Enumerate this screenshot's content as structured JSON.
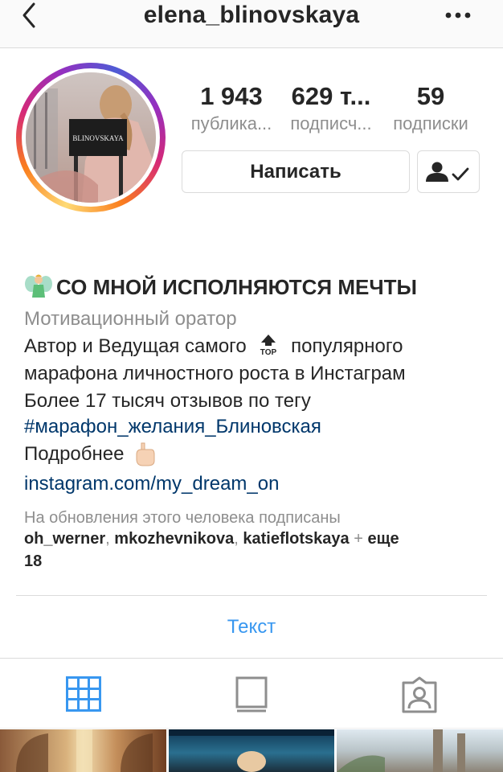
{
  "header": {
    "title": "elena_blinovskaya",
    "back_icon": "chevron-left-icon",
    "more_icon": "ellipsis-icon"
  },
  "profile": {
    "avatar_text": "BLINOVSKAYA",
    "stats": [
      {
        "value": "1 943",
        "label": "публика..."
      },
      {
        "value": "629 т...",
        "label": "подписч..."
      },
      {
        "value": "59",
        "label": "подписки"
      }
    ],
    "message_button": "Написать",
    "follow_icon": "person-check-icon"
  },
  "bio": {
    "name": "СО МНОЙ ИСПОЛНЯЮТСЯ МЕЧТЫ",
    "name_emoji": "fairy-emoji",
    "category": "Мотивационный оратор",
    "line1_a": "Автор и Ведущая самого",
    "line1_emoji": "top-arrow-emoji",
    "line1_b": "популярного",
    "line2": "марафона личностного роста в Инстаграм",
    "line3": "Более 17 тысяч отзывов по тегу",
    "hashtag": "#марафон_желания_Блиновская",
    "more": "Подробнее",
    "more_emoji": "pointing-down-emoji",
    "link": "instagram.com/my_dream_on"
  },
  "followed_by": {
    "intro": "На обновления этого человека подписаны",
    "names": [
      "oh_werner",
      "mkozhevnikova",
      "katieflotskaya"
    ],
    "plus": "+",
    "more": "еще",
    "count": "18"
  },
  "text_link": "Текст",
  "tabs": [
    {
      "icon": "grid-icon",
      "active": true
    },
    {
      "icon": "feed-icon",
      "active": false
    },
    {
      "icon": "tagged-icon",
      "active": false
    }
  ],
  "colors": {
    "accent": "#3897f0",
    "link": "#00376b",
    "muted": "#8e8e8e",
    "text": "#262626"
  }
}
